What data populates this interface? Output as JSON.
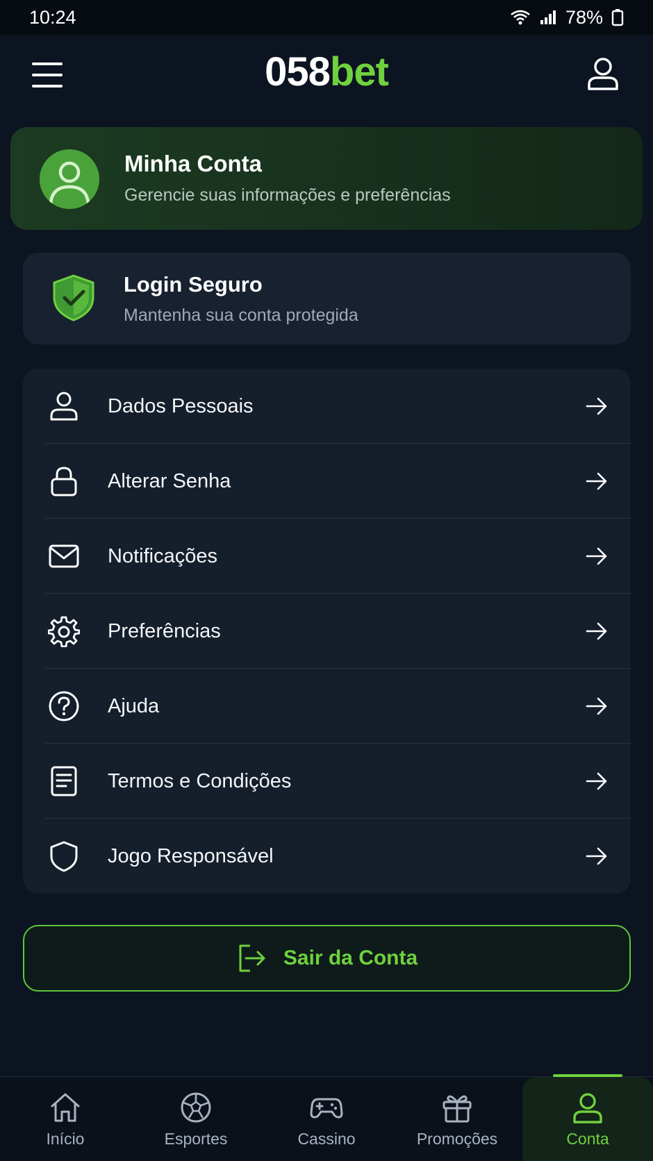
{
  "status_bar": {
    "time": "10:24",
    "battery": "78%"
  },
  "header": {
    "logo_part1": "058",
    "logo_part2": "bet"
  },
  "account_card": {
    "title": "Minha Conta",
    "subtitle": "Gerencie suas informações e preferências"
  },
  "secure_card": {
    "title": "Login Seguro",
    "subtitle": "Mantenha sua conta protegida"
  },
  "menu": {
    "items": [
      {
        "label": "Dados Pessoais",
        "icon": "user-icon"
      },
      {
        "label": "Alterar Senha",
        "icon": "lock-icon"
      },
      {
        "label": "Notificações",
        "icon": "mail-icon"
      },
      {
        "label": "Preferências",
        "icon": "gear-icon"
      },
      {
        "label": "Ajuda",
        "icon": "help-icon"
      },
      {
        "label": "Termos e Condições",
        "icon": "document-icon"
      },
      {
        "label": "Jogo Responsável",
        "icon": "shield-icon"
      }
    ]
  },
  "logout": {
    "label": "Sair da Conta"
  },
  "bottom_nav": {
    "items": [
      {
        "label": "Início",
        "icon": "home-icon"
      },
      {
        "label": "Esportes",
        "icon": "ball-icon"
      },
      {
        "label": "Cassino",
        "icon": "gamepad-icon"
      },
      {
        "label": "Promoções",
        "icon": "gift-icon"
      },
      {
        "label": "Conta",
        "icon": "user-icon"
      }
    ],
    "active": "Conta"
  },
  "colors": {
    "accent": "#6fd13f",
    "background": "#0b1420",
    "card": "#151e2b"
  }
}
